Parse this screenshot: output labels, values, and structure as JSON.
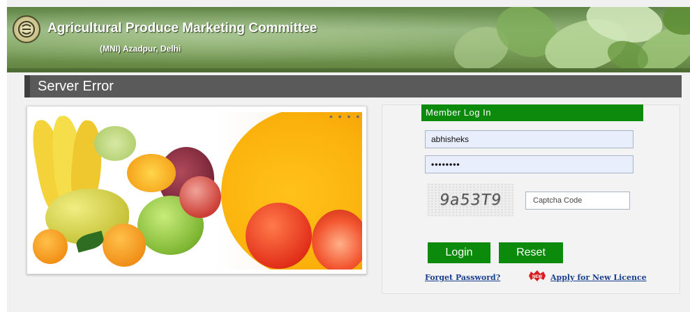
{
  "header": {
    "title": "Agricultural Produce Marketing Committee",
    "subtitle": "(MNI) Azadpur, Delhi",
    "logo_icon": "apmc-emblem-icon"
  },
  "error": {
    "title": "Server Error"
  },
  "login": {
    "heading": "Member Log In",
    "username_value": "abhisheks",
    "password_value": "••••••••",
    "captcha_text": "9a53T9",
    "captcha_placeholder": "Captcha Code",
    "login_label": "Login",
    "reset_label": "Reset",
    "forgot_label": "Forget Password?",
    "apply_label": "Apply for New Licence",
    "new_badge_text": "NEW"
  },
  "colors": {
    "accent_green": "#0b8a0b",
    "error_bar": "#5a5a5a",
    "link_blue": "#1a3f8f",
    "badge_red": "#d81e1e"
  },
  "slider": {
    "pager_dots": "• • • •"
  }
}
